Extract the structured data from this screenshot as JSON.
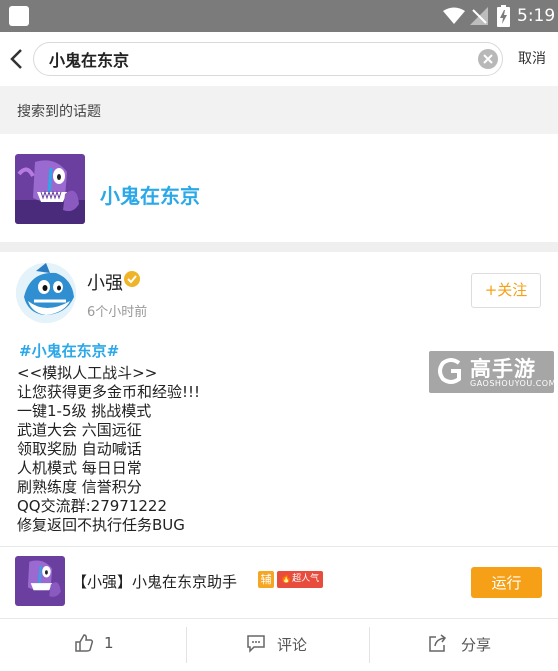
{
  "status_bar": {
    "time": "5:19"
  },
  "search": {
    "query": "小鬼在东京",
    "cancel_label": "取消"
  },
  "section": {
    "title": "搜索到的话题"
  },
  "topic": {
    "name": "小鬼在东京"
  },
  "post": {
    "username": "小强",
    "time_ago": "6个小时前",
    "follow_label": "+关注",
    "tag": "#小鬼在东京#",
    "lines": [
      "<<模拟人工战斗>>",
      "让您获得更多金币和经验!!!",
      "一键1-5级 挑战模式",
      "武道大会  六国远征",
      "领取奖励  自动喊话",
      "人机模式  每日日常",
      "刷熟练度  信誉积分",
      "QQ交流群:27971222",
      "修复返回不执行任务BUG"
    ]
  },
  "watermark": {
    "title": "高手游",
    "subtitle": "GAOSHOUYOU.COM"
  },
  "app": {
    "name": "【小强】小鬼在东京助手",
    "badge_fu": "辅",
    "badge_hot": "🔥超人气",
    "run_label": "运行"
  },
  "actions": {
    "like_count": "1",
    "comment_label": "评论",
    "share_label": "分享"
  },
  "colors": {
    "accent": "#f5a016",
    "link": "#2aa8e8"
  }
}
